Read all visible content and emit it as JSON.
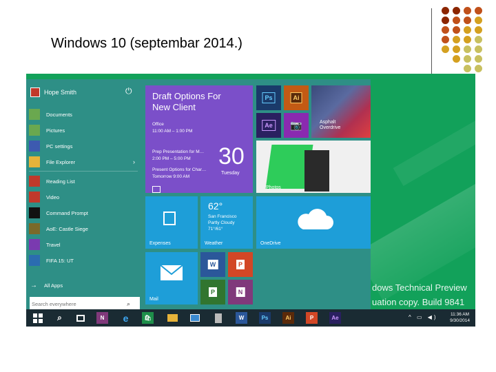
{
  "slide": {
    "title": "Windows 10  (septembar 2014.)",
    "dot_colors": [
      "#8b2500",
      "#c0501a",
      "#d4a020",
      "#c8c060"
    ]
  },
  "start_menu": {
    "user_name": "Hope Smith",
    "power_icon": "power-icon",
    "items": [
      {
        "label": "Documents",
        "icon": "documents-icon",
        "color": "#6aa84f"
      },
      {
        "label": "Pictures",
        "icon": "pictures-icon",
        "color": "#6aa84f"
      },
      {
        "label": "PC settings",
        "icon": "gear-icon",
        "color": "#3d5ab0"
      },
      {
        "label": "File Explorer",
        "icon": "folder-icon",
        "color": "#e6b33a"
      },
      {
        "label": "Reading List",
        "icon": "reading-list-icon",
        "color": "#c0392b"
      },
      {
        "label": "Video",
        "icon": "video-icon",
        "color": "#c0392b"
      },
      {
        "label": "Command Prompt",
        "icon": "command-prompt-icon",
        "color": "#111111"
      },
      {
        "label": "AoE: Castle Siege",
        "icon": "aoe-game-icon",
        "color": "#7a6a2a"
      },
      {
        "label": "Travel",
        "icon": "travel-icon",
        "color": "#7a3ab0"
      },
      {
        "label": "FIFA 15: UT",
        "icon": "fifa-icon",
        "color": "#2b6cb0"
      }
    ],
    "file_explorer_arrow": "›",
    "all_apps": "All Apps",
    "search_placeholder": "Search everywhere"
  },
  "tiles": {
    "calendar": {
      "title_line1": "Draft Options For",
      "title_line2": "New Client",
      "sub_line1": "Office",
      "sub_line2": "11:00 AM – 1:00 PM",
      "ev1_line1": "Prep Presentation for M…",
      "ev1_line2": "2:00 PM – 5:00 PM",
      "ev2_line1": "Present Options for Char…",
      "ev2_line2": "Tomorrow 9:00 AM",
      "day": "30",
      "dow": "Tuesday"
    },
    "ps": "Ps",
    "ai": "Ai",
    "ae": "Ae",
    "asphalt_line1": "Asphalt",
    "asphalt_line2": "Overdrive",
    "photos": "Photos",
    "expenses": "Expenses",
    "weather": {
      "temp": "62°",
      "city": "San Francisco",
      "cond": "Partly Cloudy",
      "range": "71°/61°",
      "label": "Weather"
    },
    "onedrive": "OneDrive",
    "mail": "Mail",
    "word": "W",
    "powerpoint": "P",
    "project": "P",
    "onenote": "N"
  },
  "taskbar": {
    "icons": [
      "windows-start-icon",
      "search-icon",
      "task-view-icon",
      "onenote-icon",
      "internet-explorer-icon",
      "store-icon",
      "file-explorer-icon",
      "photos-icon",
      "phone-icon",
      "word-icon",
      "photoshop-icon",
      "illustrator-icon",
      "powerpoint-icon",
      "after-effects-icon"
    ],
    "onenote": "N",
    "word": "W",
    "ps": "Ps",
    "ai": "Ai",
    "pp": "P",
    "ae": "Ae",
    "time": "11:36 AM",
    "date": "9/30/2014"
  },
  "watermark": {
    "line1": "dows Technical Preview",
    "line2": "uation copy. Build 9841"
  }
}
